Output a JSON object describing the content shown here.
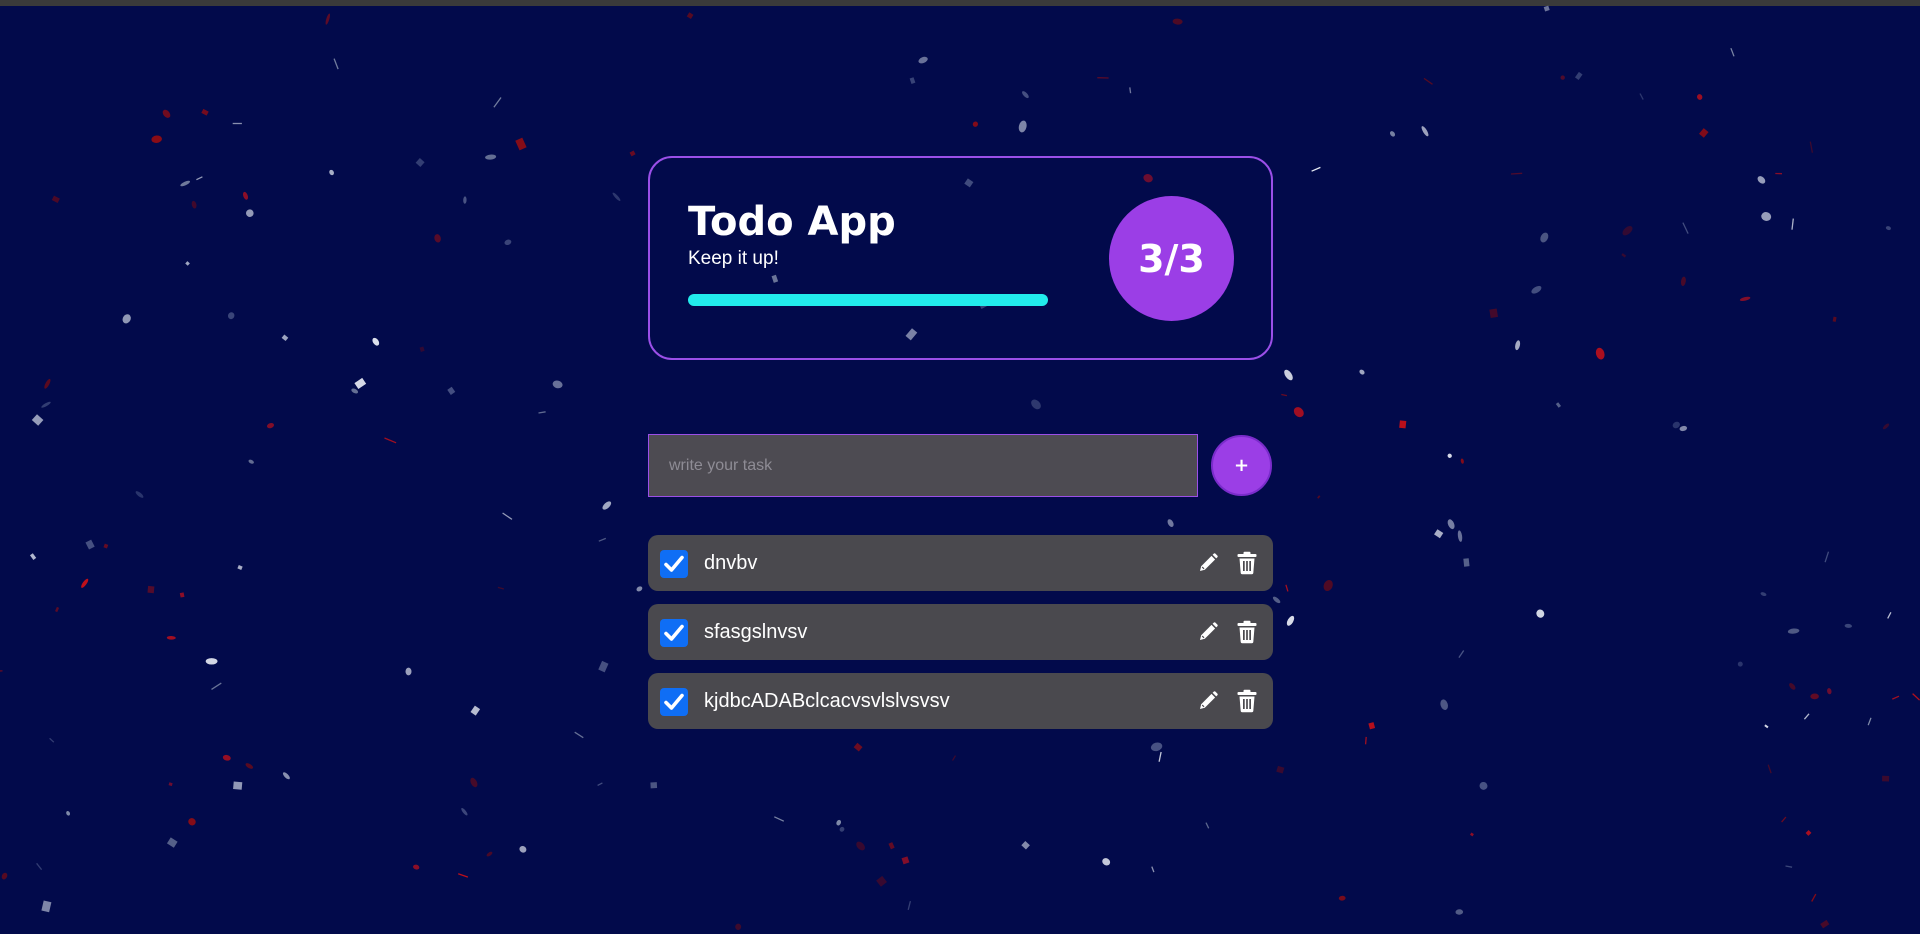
{
  "stats": {
    "title": "Todo App",
    "subtitle": "Keep it up!",
    "completed": 3,
    "total": 3,
    "counter_text": "3/3",
    "progress_fraction": 1.0
  },
  "form": {
    "input_value": "",
    "input_placeholder": "write your task",
    "add_label": "+"
  },
  "todos": [
    {
      "text": "dnvbv",
      "completed": true
    },
    {
      "text": "sfasgslnvsv",
      "completed": true
    },
    {
      "text": "kjdbcADABclcacvsvlslvsvsv",
      "completed": true
    }
  ],
  "icons": {
    "checkbox": "check-icon",
    "edit": "pencil-icon",
    "delete": "trash-icon"
  },
  "colors": {
    "background": "#020a4b",
    "accent": "#9b3ee6",
    "progress": "#22ecec",
    "checkbox": "#0f6ef5",
    "item_background": "#4a494e",
    "confetti_red": "#c0101a",
    "confetti_white": "#e8ecf4"
  }
}
